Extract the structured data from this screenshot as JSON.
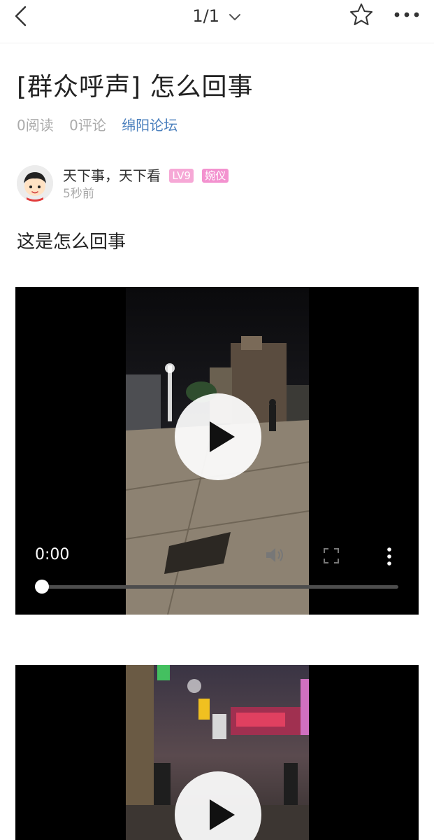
{
  "nav": {
    "back_icon": "chevron-left-icon",
    "pager": "1/1",
    "pager_icon": "chevron-down-icon",
    "favorite_icon": "star-icon",
    "more_icon": "more-horizontal-icon"
  },
  "post": {
    "title": "[群众呼声] 怎么回事",
    "reads": "0阅读",
    "comments": "0评论",
    "forum": "绵阳论坛",
    "body": "这是怎么回事"
  },
  "author": {
    "name": "天下事，天下看",
    "level": "LV9",
    "role": "婉仪",
    "time": "5秒前"
  },
  "videos": [
    {
      "current_time": "0:00",
      "progress": 0,
      "icons": [
        "play-icon",
        "volume-icon",
        "fullscreen-icon",
        "more-vertical-icon"
      ]
    },
    {
      "icons": [
        "play-icon"
      ]
    }
  ],
  "colors": {
    "forum_link": "#4a7fbd",
    "badge_level": "#f6a8d6",
    "badge_role": "#f392cf",
    "meta_text": "#aaaaaa"
  }
}
